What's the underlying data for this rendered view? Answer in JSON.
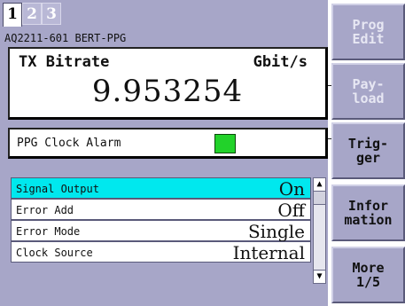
{
  "tabs": [
    {
      "label": "1",
      "active": true
    },
    {
      "label": "2",
      "active": false
    },
    {
      "label": "3",
      "active": false
    }
  ],
  "title": "AQ2211-601 BERT-PPG",
  "tx_bitrate": {
    "label": "TX Bitrate",
    "unit": "Gbit/s",
    "value": "9.953254"
  },
  "alarm": {
    "label": "PPG Clock Alarm",
    "led_color": "#22d22a"
  },
  "settings": [
    {
      "label": "Signal Output",
      "value": "On",
      "selected": true
    },
    {
      "label": "Error Add",
      "value": "Off",
      "selected": false
    },
    {
      "label": "Error Mode",
      "value": "Single",
      "selected": false
    },
    {
      "label": "Clock Source",
      "value": "Internal",
      "selected": false
    }
  ],
  "scrollbar": {
    "up_icon": "▲",
    "down_icon": "▼"
  },
  "softkeys": [
    {
      "label": "Prog\nEdit",
      "enabled": false
    },
    {
      "label": "Pay-\nload",
      "enabled": false
    },
    {
      "label": "Trig-\nger",
      "enabled": true
    },
    {
      "label": "Infor\nmation",
      "enabled": true
    },
    {
      "label": "More\n1/5",
      "enabled": true
    }
  ],
  "colors": {
    "panel": "#a7a6c8",
    "selected_row": "#00e8ee",
    "alarm_led": "#22d22a"
  }
}
